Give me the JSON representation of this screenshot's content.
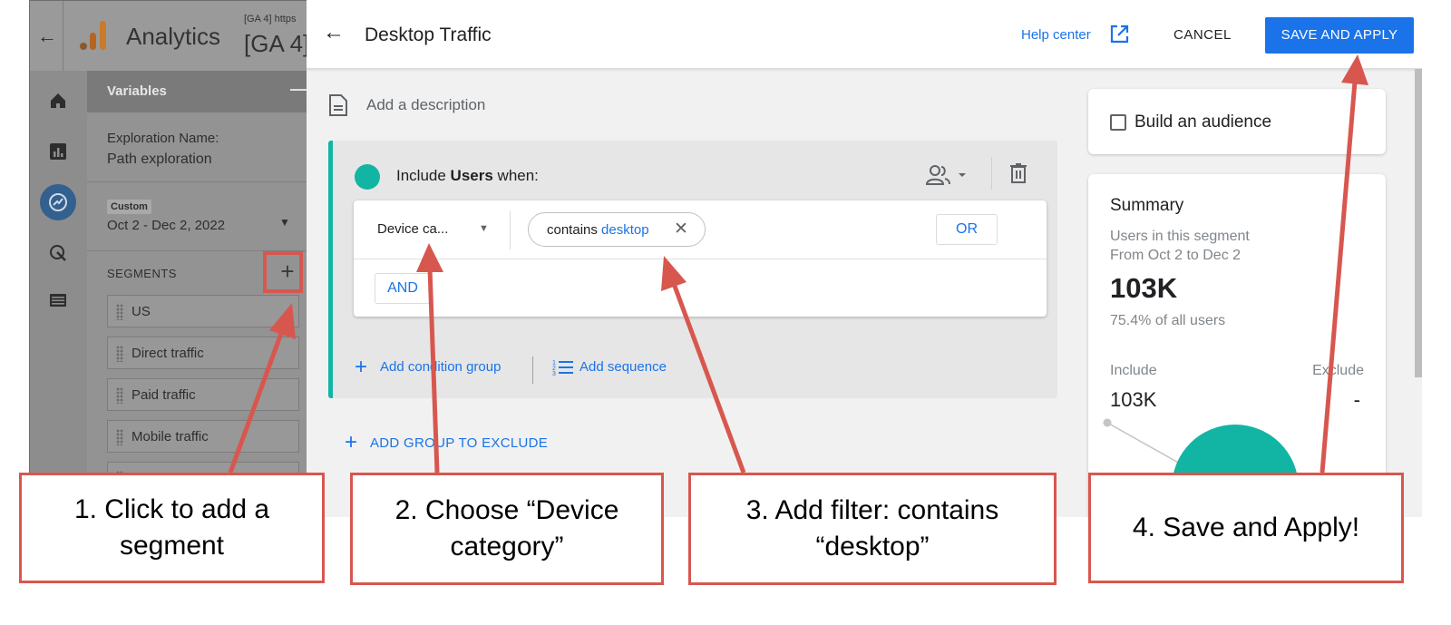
{
  "app": {
    "name": "Analytics",
    "property_small": "[GA 4] https",
    "property_big": "[GA 4]"
  },
  "variables_panel": {
    "title": "Variables",
    "exploration_label": "Exploration Name:",
    "exploration_value": "Path exploration",
    "date_chip": "Custom",
    "date_range": "Oct 2 - Dec 2, 2022",
    "segments_label": "SEGMENTS",
    "segments": [
      "US",
      "Direct traffic",
      "Paid traffic",
      "Mobile traffic"
    ]
  },
  "modal": {
    "title": "Desktop Traffic",
    "help_center": "Help center",
    "cancel_label": "CANCEL",
    "save_label": "SAVE AND APPLY",
    "description_placeholder": "Add a description",
    "include_prefix": "Include ",
    "include_bold": "Users",
    "include_suffix": " when:",
    "dimension": "Device ca...",
    "filter_op": "contains ",
    "filter_value": "desktop",
    "or_label": "OR",
    "and_label": "AND",
    "add_condition_group": "Add condition group",
    "add_sequence": "Add sequence",
    "add_exclude_group": "ADD GROUP TO EXCLUDE"
  },
  "audience": {
    "label": "Build an audience",
    "checked": false
  },
  "summary": {
    "title": "Summary",
    "users_label": "Users in this segment",
    "range": "From Oct 2 to Dec 2",
    "count": "103K",
    "percent_text": "75.4% of all users",
    "include_label": "Include",
    "exclude_label": "Exclude",
    "include_value": "103K",
    "exclude_value": "-"
  },
  "callouts": {
    "step1": "1. Click to add a segment",
    "step2": "2. Choose “Device category”",
    "step3": "3. Add filter: contains “desktop”",
    "step4": "4. Save and Apply!"
  },
  "colors": {
    "accent_blue": "#1a73e8",
    "segment_teal": "#12b5a4",
    "annotation_red": "#d7574f"
  },
  "icons": {
    "back": "arrow-back-icon",
    "help_external": "open-in-new-icon",
    "description": "description-icon",
    "scope": "users-scope-icon",
    "delete": "trash-icon",
    "sequence": "sequence-icon"
  }
}
